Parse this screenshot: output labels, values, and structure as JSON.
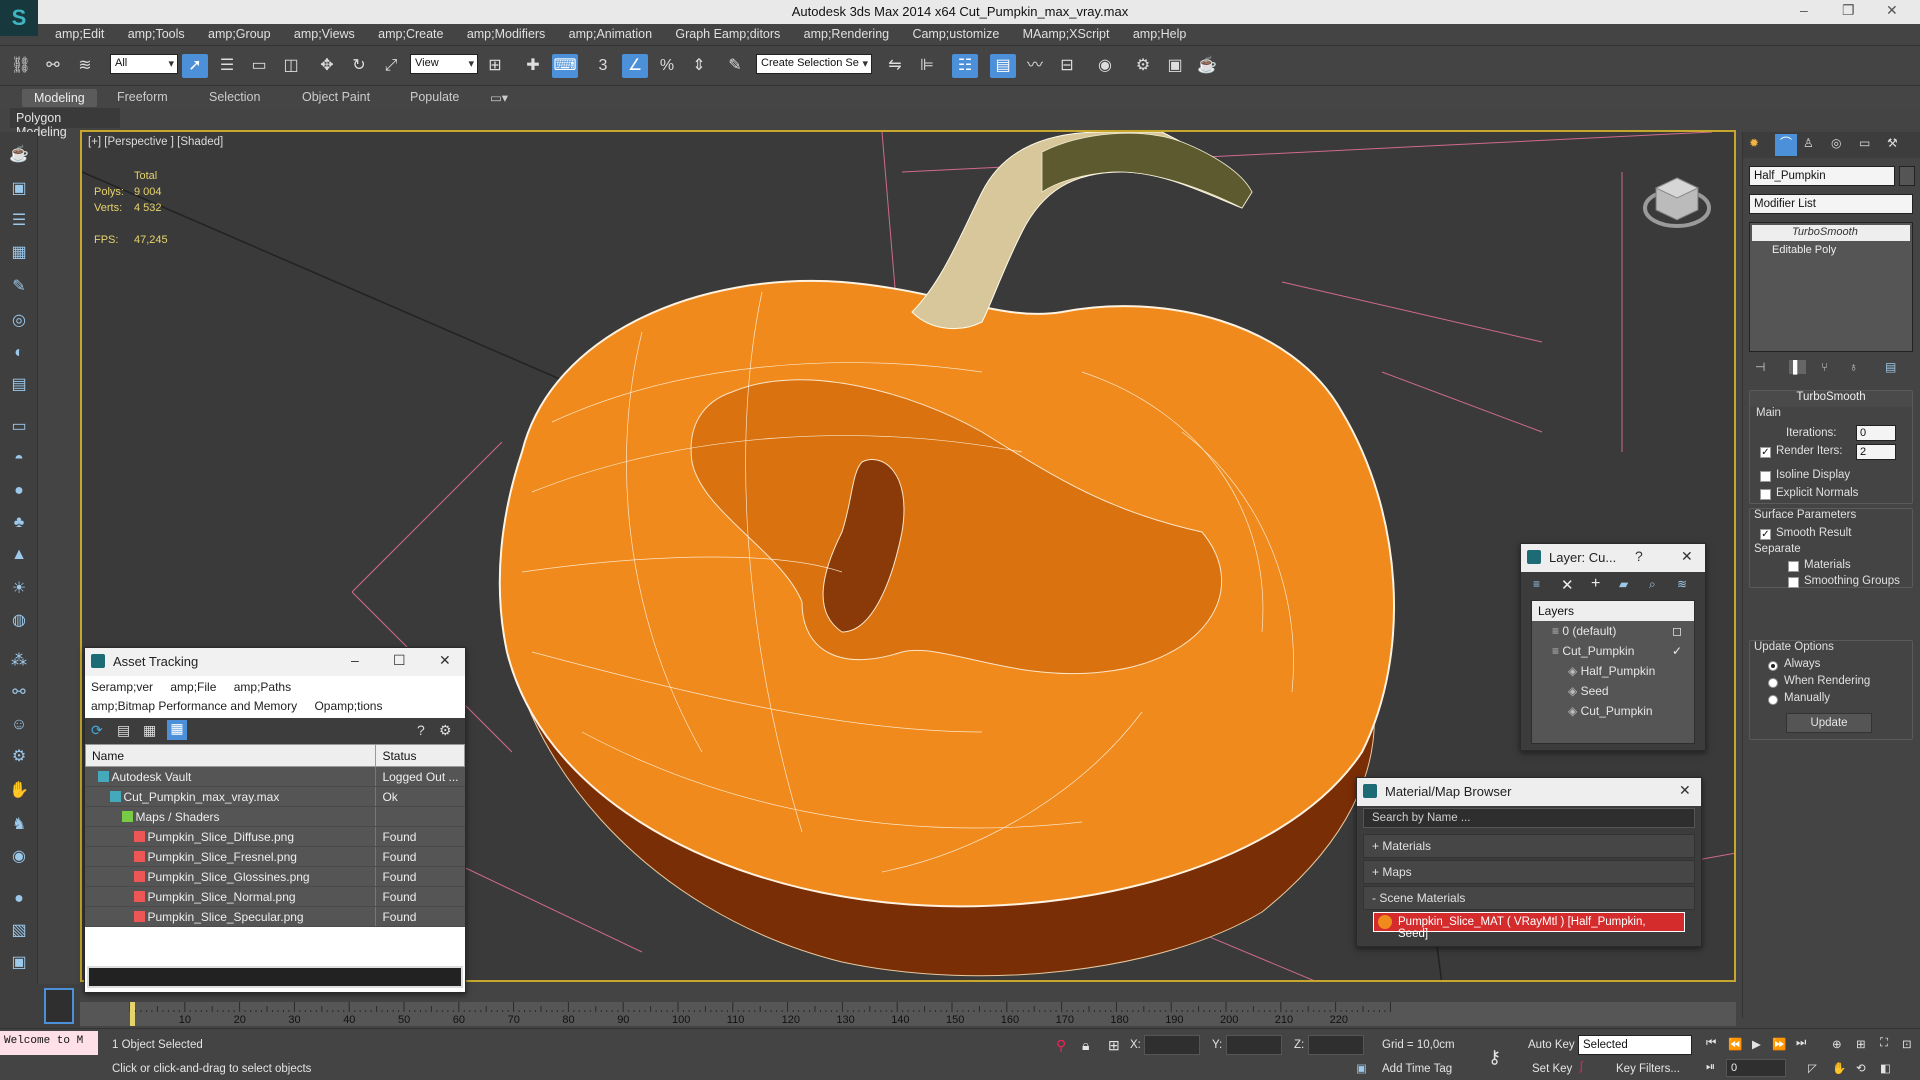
{
  "window": {
    "title": "Autodesk 3ds Max  2014 x64     Cut_Pumpkin_max_vray.max"
  },
  "menu": [
    "amp;Edit",
    "amp;Tools",
    "amp;Group",
    "amp;Views",
    "amp;Create",
    "amp;Modifiers",
    "amp;Animation",
    "Graph Eamp;ditors",
    "amp;Rendering",
    "Camp;ustomize",
    "MAamp;XScript",
    "amp;Help"
  ],
  "toolbar": {
    "selection_filter": "All",
    "ref_coord": "View",
    "named_selection": "Create Selection Se"
  },
  "ribbon": {
    "tabs": [
      "Modeling",
      "Freeform",
      "Selection",
      "Object Paint",
      "Populate"
    ],
    "sub": "Polygon Modeling"
  },
  "viewport": {
    "label": "[+] [Perspective ] [Shaded]",
    "stats": {
      "total_label": "Total",
      "polys_label": "Polys:",
      "polys_value": "9 004",
      "verts_label": "Verts:",
      "verts_value": "4 532",
      "fps_label": "FPS:",
      "fps_value": "47,245"
    }
  },
  "asset_tracking": {
    "title": "Asset Tracking",
    "menu1": [
      "Seramp;ver",
      "amp;File",
      "amp;Paths"
    ],
    "menu2": [
      "amp;Bitmap Performance and Memory",
      "Opamp;tions"
    ],
    "columns": [
      "Name",
      "Status"
    ],
    "rows": [
      {
        "name": "Autodesk Vault",
        "status": "Logged Out ...",
        "indent": 1,
        "icon": "vault-icon"
      },
      {
        "name": "Cut_Pumpkin_max_vray.max",
        "status": "Ok",
        "indent": 2,
        "icon": "max-file-icon"
      },
      {
        "name": "Maps / Shaders",
        "status": "",
        "indent": 3,
        "icon": "maps-icon"
      },
      {
        "name": "Pumpkin_Slice_Diffuse.png",
        "status": "Found",
        "indent": 4,
        "icon": "png-icon"
      },
      {
        "name": "Pumpkin_Slice_Fresnel.png",
        "status": "Found",
        "indent": 4,
        "icon": "png-icon"
      },
      {
        "name": "Pumpkin_Slice_Glossines.png",
        "status": "Found",
        "indent": 4,
        "icon": "png-icon"
      },
      {
        "name": "Pumpkin_Slice_Normal.png",
        "status": "Found",
        "indent": 4,
        "icon": "png-icon"
      },
      {
        "name": "Pumpkin_Slice_Specular.png",
        "status": "Found",
        "indent": 4,
        "icon": "png-icon"
      }
    ]
  },
  "layer_panel": {
    "title": "Layer: Cu...",
    "header": "Layers",
    "rows": [
      {
        "name": "0 (default)",
        "indent": 0
      },
      {
        "name": "Cut_Pumpkin",
        "indent": 0
      },
      {
        "name": "Half_Pumpkin",
        "indent": 1
      },
      {
        "name": "Seed",
        "indent": 1
      },
      {
        "name": "Cut_Pumpkin",
        "indent": 1
      }
    ]
  },
  "material_browser": {
    "title": "Material/Map Browser",
    "search_placeholder": "Search by Name ...",
    "groups": [
      "+ Materials",
      "+ Maps",
      "- Scene Materials"
    ],
    "scene_material": "Pumpkin_Slice_MAT  ( VRayMtl ) [Half_Pumpkin, Seed]"
  },
  "command_panel": {
    "object_name": "Half_Pumpkin",
    "modifier_list": "Modifier List",
    "stack": [
      "TurboSmooth",
      "Editable Poly"
    ],
    "rollout_title": "TurboSmooth",
    "main_label": "Main",
    "iterations_label": "Iterations:",
    "iterations_value": "0",
    "render_iters_label": "Render Iters:",
    "render_iters_value": "2",
    "isoline": "Isoline Display",
    "explicit": "Explicit Normals",
    "surface_label": "Surface Parameters",
    "smooth_result": "Smooth Result",
    "separate_label": "Separate",
    "materials": "Materials",
    "smoothing_groups": "Smoothing Groups",
    "update_label": "Update Options",
    "always": "Always",
    "when_rendering": "When Rendering",
    "manually": "Manually",
    "update_btn": "Update"
  },
  "timeline": {
    "ticks": [
      "10",
      "20",
      "30",
      "40",
      "50",
      "60",
      "70",
      "80",
      "90",
      "100",
      "110",
      "120",
      "130",
      "140",
      "150",
      "160",
      "170",
      "180",
      "190",
      "200",
      "210",
      "220"
    ]
  },
  "status": {
    "selected": "1 Object Selected",
    "prompt": "Click or click-and-drag to select objects",
    "welcome": "Welcome to M",
    "x_label": "X:",
    "y_label": "Y:",
    "z_label": "Z:",
    "grid": "Grid = 10,0cm",
    "auto_key": "Auto Key",
    "selected_dd": "Selected",
    "set_key": "Set Key",
    "key_filters": "Key Filters...",
    "add_time_tag": "Add Time Tag",
    "frame": "0"
  },
  "colors": {
    "accent": "#4b90d8",
    "viewport_border": "#c8a82c",
    "pumpkin": "#f08a1c"
  }
}
